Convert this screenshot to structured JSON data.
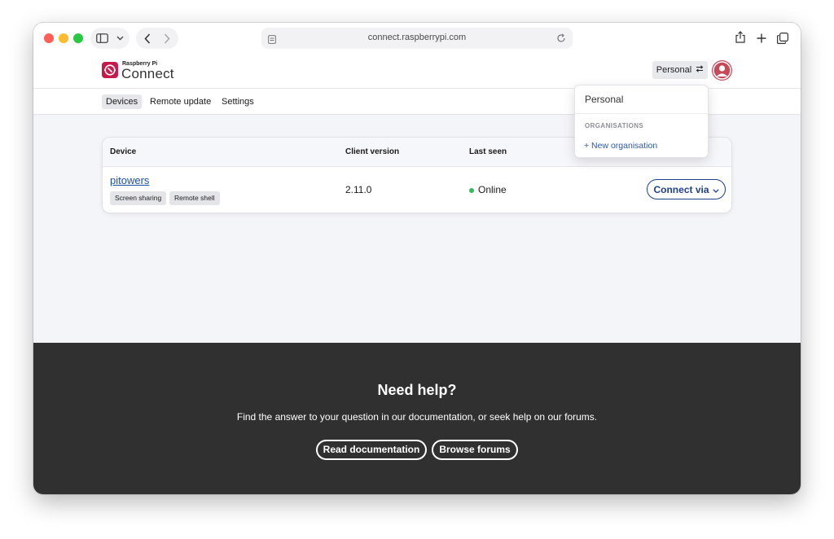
{
  "browser": {
    "url": "connect.raspberrypi.com",
    "icons": [
      "sidebar-icon",
      "chevron-down-icon",
      "back-icon",
      "forward-icon",
      "page-icon",
      "reload-icon",
      "share-icon",
      "new-tab-icon",
      "tabs-overview-icon"
    ]
  },
  "header": {
    "logo_small": "Raspberry Pi",
    "logo_big": "Connect",
    "org_switch_label": "Personal",
    "colors": {
      "brand": "#c51a4a",
      "link": "#1e4ea0"
    }
  },
  "nav": {
    "items": [
      {
        "label": "Devices",
        "active": true
      },
      {
        "label": "Remote update",
        "active": false
      },
      {
        "label": "Settings",
        "active": false
      }
    ]
  },
  "dropdown": {
    "current": "Personal",
    "section_heading": "ORGANISATIONS",
    "new_org_label": "+ New organisation"
  },
  "table": {
    "headers": [
      "Device",
      "Client version",
      "Last seen"
    ],
    "rows": [
      {
        "device": "pitowers",
        "tags": [
          "Screen sharing",
          "Remote shell"
        ],
        "client_version": "2.11.0",
        "last_seen": "Online",
        "status_color": "#2dbd5a",
        "action_label": "Connect via"
      }
    ]
  },
  "footer": {
    "title": "Need help?",
    "text": "Find the answer to your question in our documentation, or seek help on our forums.",
    "buttons": [
      "Read documentation",
      "Browse forums"
    ]
  }
}
